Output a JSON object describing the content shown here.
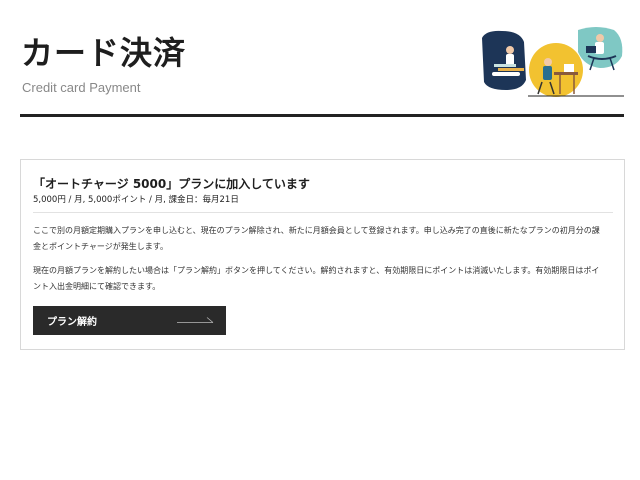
{
  "header": {
    "title": "カード決済",
    "subtitle": "Credit card Payment"
  },
  "plan": {
    "title": "「オートチャージ 5000」プランに加入しています",
    "meta": "5,000円 / 月, 5,000ポイント / 月, 課金日：毎月21日",
    "paragraph1_line1": "ここで別の月額定期購入プランを申し込むと、現在のプラン解除され、新たに月額会員として登録されます。申し込み完了の直後に新たなプランの初月分の課",
    "paragraph1_line2": "金とポイントチャージが発生します。",
    "paragraph2_line1": "現在の月額プランを解約したい場合は「プラン解約」ボタンを押してください。解約されますと、有効期限日にポイントは消滅いたします。有効期限日はポイ",
    "paragraph2_line2": "ント入出金明細にて確認できます。"
  },
  "actions": {
    "cancel_label": "プラン解約"
  },
  "icons": {
    "illustration": "people-working-illustration-icon",
    "arrow": "arrow-right-icon"
  },
  "colors": {
    "ink": "#1e1e1e",
    "button": "#2a2a2a",
    "navy": "#1d3557",
    "teal": "#7fc8c4",
    "yellow": "#f2c230"
  }
}
